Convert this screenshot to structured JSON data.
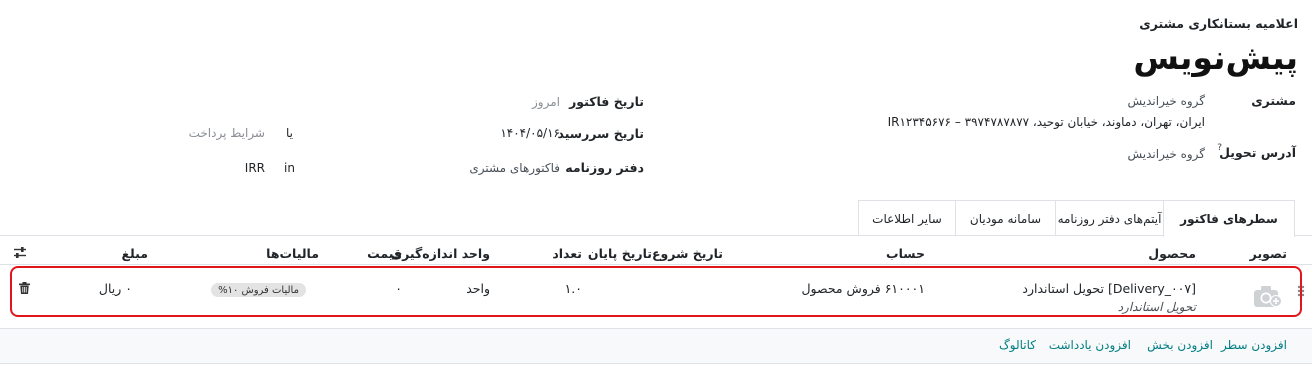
{
  "header": {
    "subtitle": "اعلامیه بستانکاری مشتری",
    "title": "پیش‌نویس"
  },
  "fields": {
    "customer_label": "مشتری",
    "customer_name": "گروه خیراندیش",
    "customer_address": "ایران، تهران، دماوند، خیابان توحید، ۳۹۷۴۷۸۷۸۷۷ – IR۱۲۳۴۵۶۷۶",
    "delivery_label": "آدرس تحویل",
    "delivery_help": "?",
    "delivery_value": "گروه خیراندیش",
    "invoice_date_label": "تاریخ فاکتور",
    "invoice_date_placeholder": "امروز",
    "due_date_label": "تاریخ سررسید",
    "due_date_value": "۱۴۰۴/۰۵/۱۶",
    "or_text": "یا",
    "payment_terms_placeholder": "شرایط پرداخت",
    "journal_label": "دفتر روزنامه",
    "journal_value": "فاکتورهای مشتری",
    "in_text": "in",
    "currency_value": "IRR"
  },
  "tabs": [
    {
      "label": "سطرهای فاکتور",
      "active": true
    },
    {
      "label": "آیتم‌های دفتر روزنامه",
      "active": false
    },
    {
      "label": "سامانه مودیان",
      "active": false
    },
    {
      "label": "سایر اطلاعات",
      "active": false
    }
  ],
  "table": {
    "columns": {
      "image": "تصویر",
      "product": "محصول",
      "account": "حساب",
      "start_date": "تاریخ شروع",
      "end_date": "تاریخ پایان",
      "quantity": "تعداد",
      "uom": "واحد اندازه‌گیری",
      "price": "قیمت",
      "taxes": "مالیات‌ها",
      "amount": "مبلغ"
    },
    "row": {
      "product": "[Delivery_۰۰۷] تحویل استاندارد",
      "description": "تحویل استاندارد",
      "account": "۶۱۰۰۰۱ فروش محصول",
      "quantity": "۱.۰",
      "uom": "واحد",
      "price": "۰",
      "tax": "مالیات فروش ۱۰%",
      "amount": "۰ ریال"
    }
  },
  "footer_links": {
    "add_line": "افزودن سطر",
    "add_section": "افزودن بخش",
    "add_note": "افزودن یادداشت",
    "catalog": "کاتالوگ"
  },
  "icons": {
    "settings": "sliders-icon",
    "delete": "trash-icon",
    "image_placeholder": "camera-plus-icon",
    "drag_handle": "drag-handle-icon"
  },
  "colors": {
    "highlight_border": "#e0161b",
    "link": "#017e84",
    "tax_badge_bg": "#e3e3e3"
  }
}
